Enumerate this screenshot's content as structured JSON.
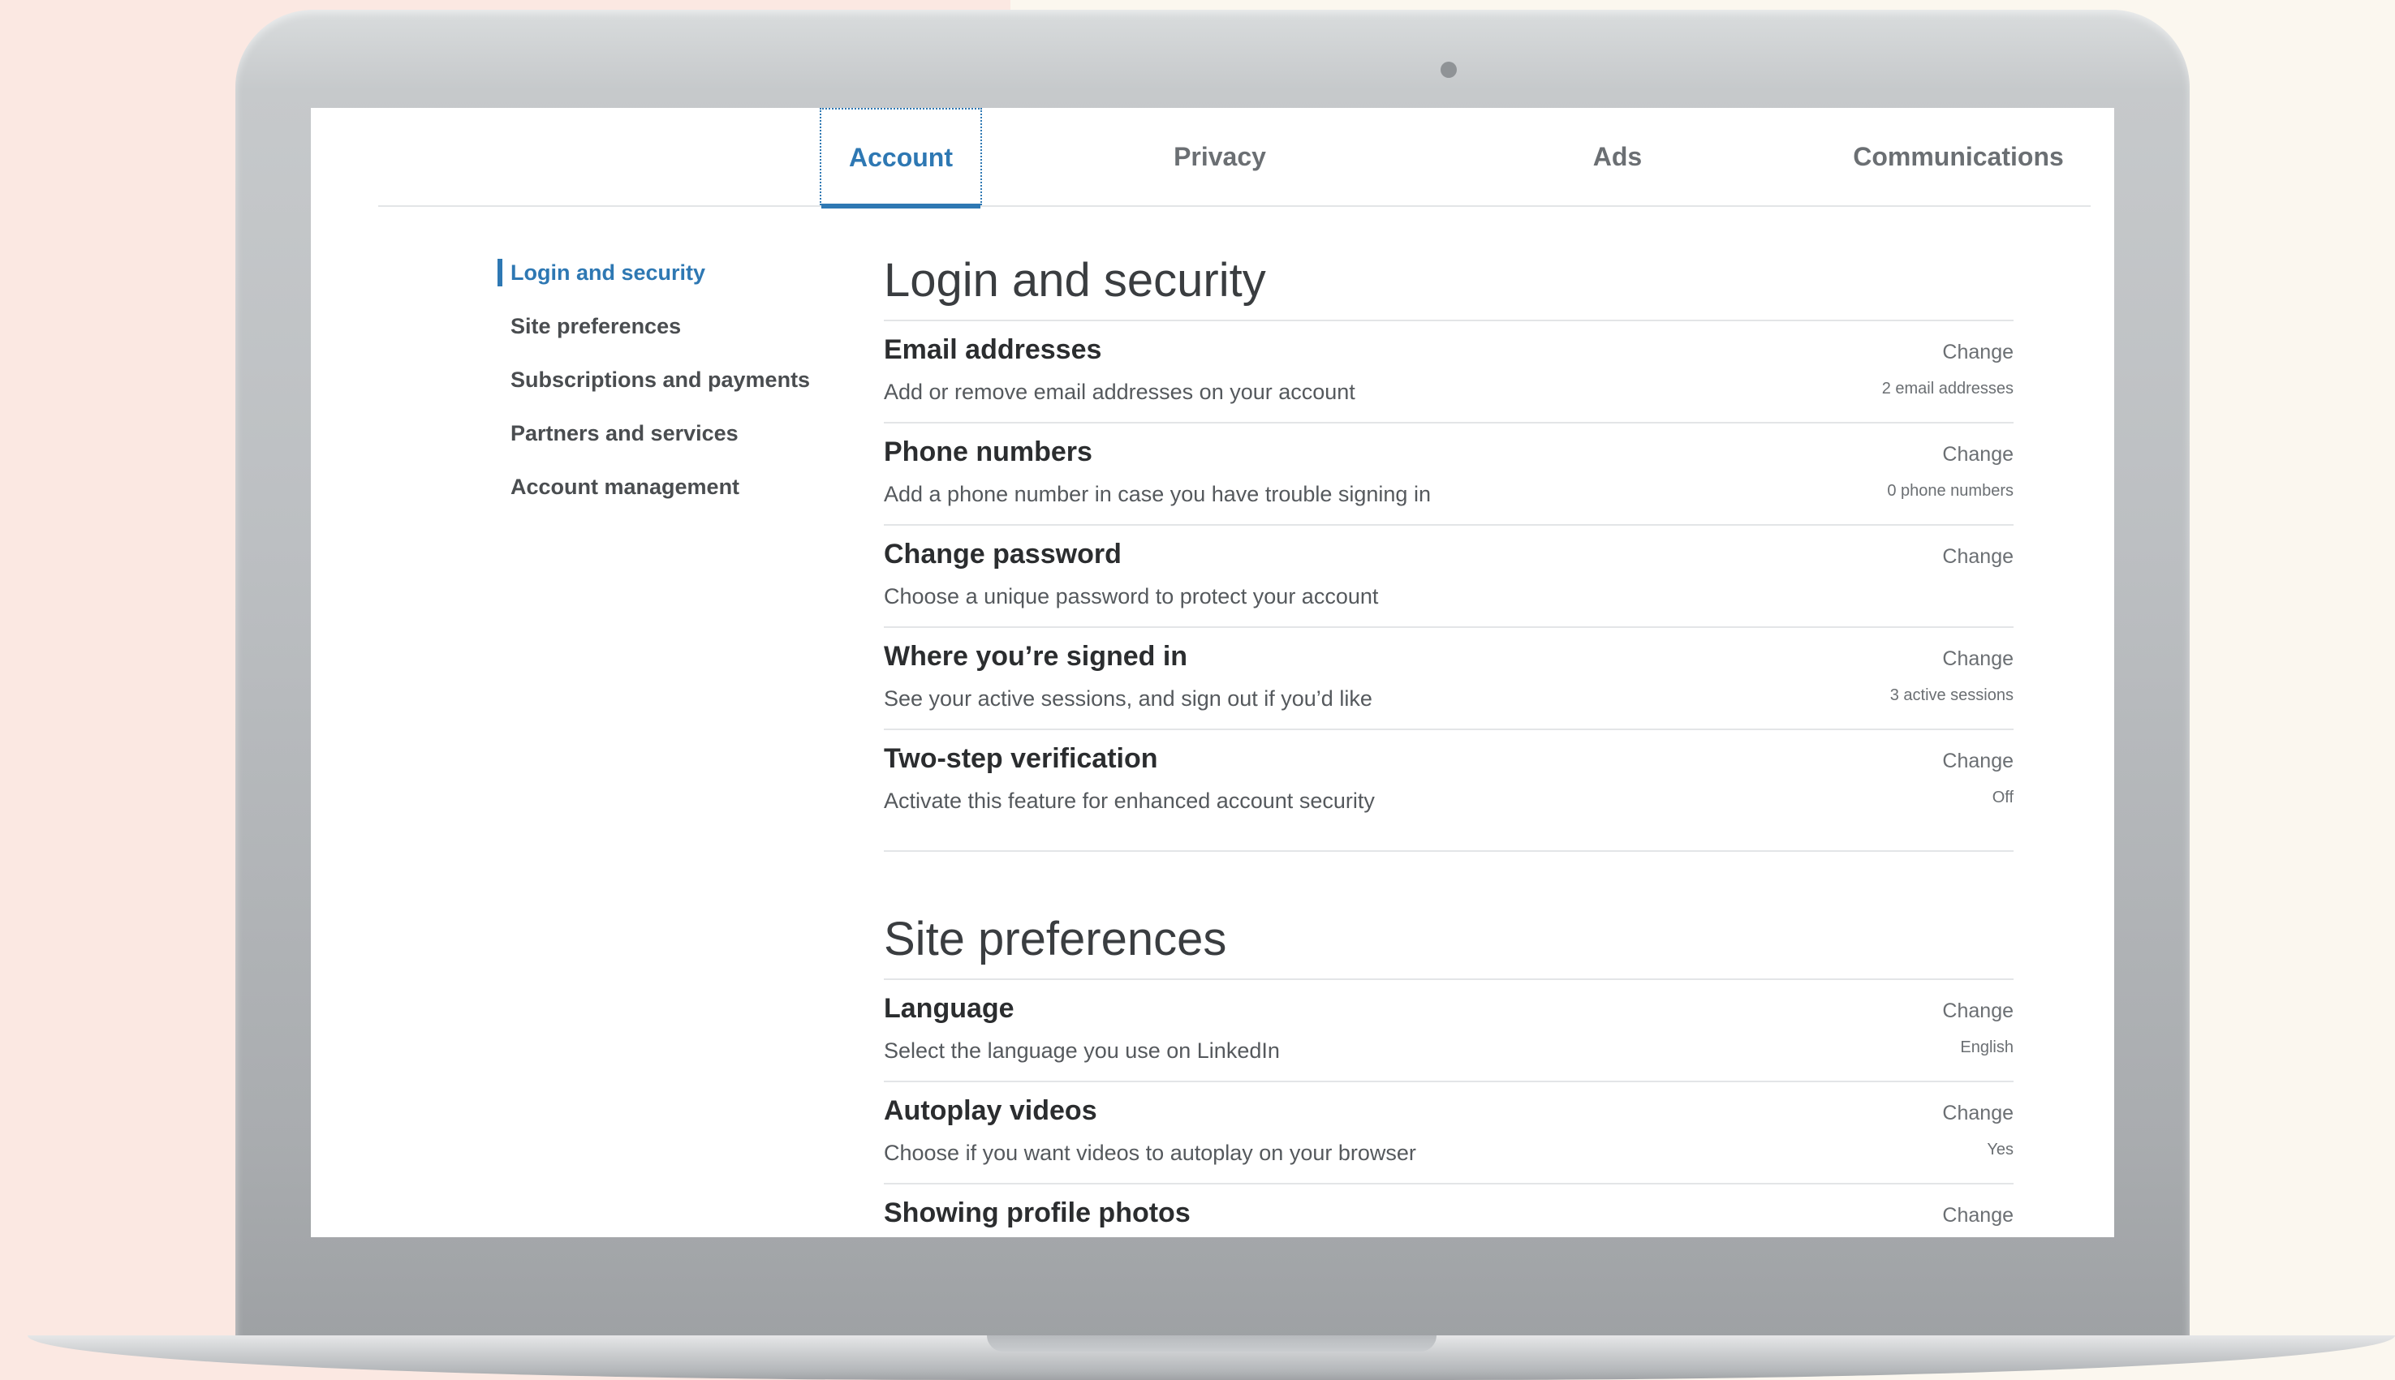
{
  "tabs": [
    {
      "label": "Account",
      "active": true
    },
    {
      "label": "Privacy",
      "active": false
    },
    {
      "label": "Ads",
      "active": false
    },
    {
      "label": "Communications",
      "active": false
    }
  ],
  "sidebar": {
    "items": [
      {
        "label": "Login and security",
        "active": true
      },
      {
        "label": "Site preferences",
        "active": false
      },
      {
        "label": "Subscriptions and payments",
        "active": false
      },
      {
        "label": "Partners and services",
        "active": false
      },
      {
        "label": "Account management",
        "active": false
      }
    ]
  },
  "sections": {
    "login": {
      "title": "Login and security",
      "rows": [
        {
          "title": "Email addresses",
          "desc": "Add or remove email addresses on your account",
          "action": "Change",
          "status": "2 email addresses"
        },
        {
          "title": "Phone numbers",
          "desc": "Add a phone number in case you have trouble signing in",
          "action": "Change",
          "status": "0 phone numbers"
        },
        {
          "title": "Change password",
          "desc": "Choose a unique password to protect your account",
          "action": "Change",
          "status": ""
        },
        {
          "title": "Where you’re signed in",
          "desc": "See your active sessions, and sign out if you’d like",
          "action": "Change",
          "status": "3 active sessions"
        },
        {
          "title": "Two-step verification",
          "desc": "Activate this feature for enhanced account security",
          "action": "Change",
          "status": "Off"
        }
      ]
    },
    "site": {
      "title": "Site preferences",
      "rows": [
        {
          "title": "Language",
          "desc": "Select the language you use on LinkedIn",
          "action": "Change",
          "status": "English"
        },
        {
          "title": "Autoplay videos",
          "desc": "Choose if you want videos to autoplay on your browser",
          "action": "Change",
          "status": "Yes"
        },
        {
          "title": "Showing profile photos",
          "desc": "",
          "action": "Change",
          "status": ""
        }
      ]
    }
  },
  "colors": {
    "accent": "#2e78b3",
    "text": "#2b2d2f",
    "muted": "#6b6f73",
    "divider": "#e3e5e7",
    "bg_left": "#fbe8e2",
    "bg_right": "#fbf7ef"
  }
}
